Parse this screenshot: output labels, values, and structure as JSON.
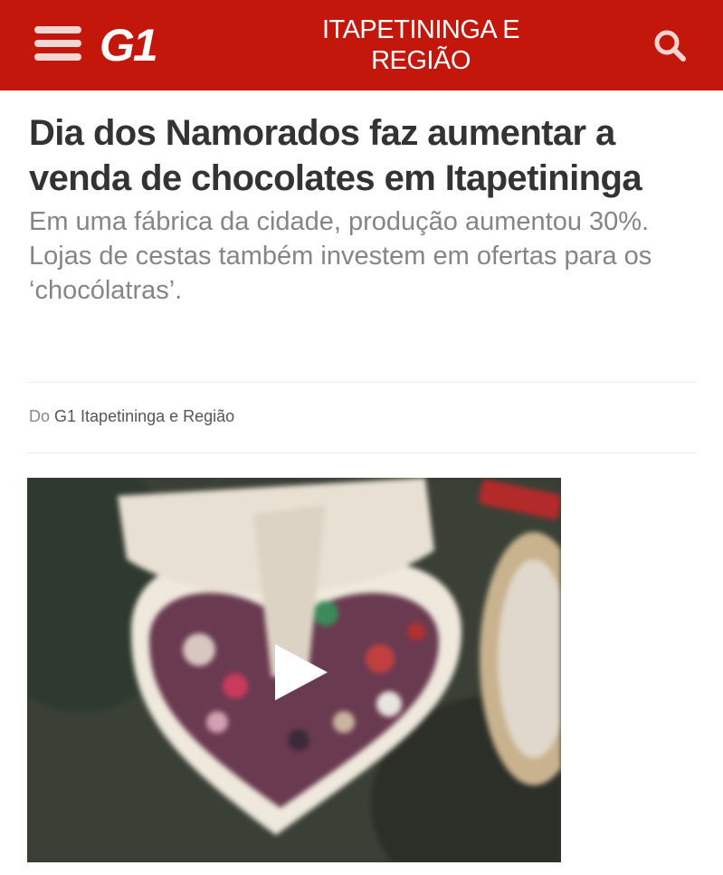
{
  "header": {
    "logo": "G1",
    "region_line1": "ITAPETININGA E",
    "region_line2": "REGIÃO",
    "icons": {
      "menu": "hamburger-menu-icon",
      "search": "search-icon"
    },
    "background": "#c4170c"
  },
  "article": {
    "title": "Dia dos Namorados faz aumentar a venda de chocolates em Itapetininga",
    "subtitle": "Em uma fábrica da cidade, produção aumentou 30%. Lojas de cestas também investem em ofertas para os ‘chocólatras’.",
    "byline_prefix": "Do",
    "byline_source": "G1 Itapetininga e Região"
  },
  "video": {
    "icon": "play-icon"
  },
  "colors": {
    "brand_red": "#c4170c",
    "title_text": "#333333",
    "subtitle_text": "#858585"
  }
}
